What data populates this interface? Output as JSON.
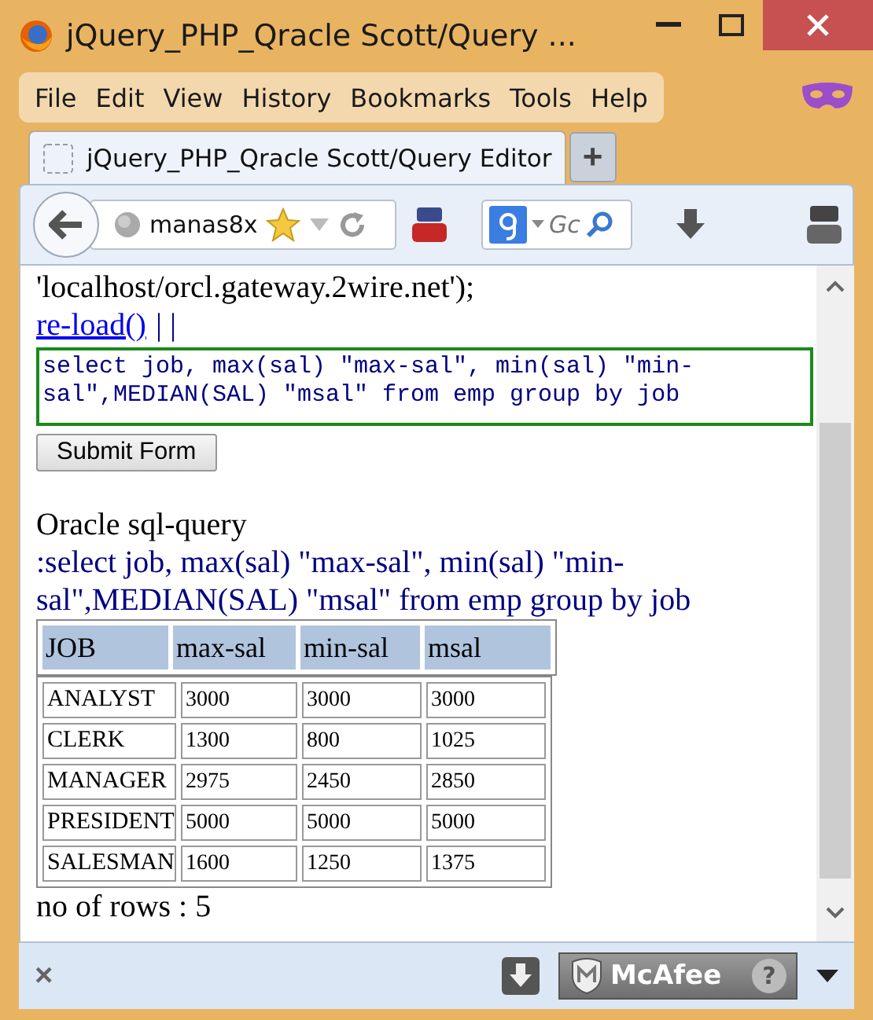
{
  "window": {
    "title": "jQuery_PHP_Qracle Scott/Query ..."
  },
  "menu": [
    {
      "label": "File"
    },
    {
      "label": "Edit"
    },
    {
      "label": "View"
    },
    {
      "label": "History"
    },
    {
      "label": "Bookmarks"
    },
    {
      "label": "Tools"
    },
    {
      "label": "Help"
    }
  ],
  "tabs": [
    {
      "label": "jQuery_PHP_Qracle Scott/Query Editor",
      "selected": true
    }
  ],
  "new_tab": "+",
  "address": {
    "value": "manas8x"
  },
  "search": {
    "placeholder": "Gc"
  },
  "page": {
    "intro": "'localhost/orcl.gateway.2wire.net');",
    "link": "re-load()",
    "separator": "| |",
    "query": "select job, max(sal) \"max-sal\", min(sal) \"min-sal\",MEDIAN(SAL) \"msal\" from emp group by job",
    "submit": "Submit Form",
    "heading": "Oracle sql-query",
    "echo": ":select job, max(sal) \"max-sal\", min(sal) \"min-sal\",MEDIAN(SAL) \"msal\" from emp group by job",
    "table": {
      "columns": [
        "JOB",
        "max-sal",
        "min-sal",
        "msal"
      ],
      "rows": [
        [
          "ANALYST",
          "3000",
          "3000",
          "3000"
        ],
        [
          "CLERK",
          "1300",
          "800",
          "1025"
        ],
        [
          "MANAGER",
          "2975",
          "2450",
          "2850"
        ],
        [
          "PRESIDENT",
          "5000",
          "5000",
          "5000"
        ],
        [
          "SALESMAN",
          "1600",
          "1250",
          "1375"
        ]
      ]
    },
    "row_count": "no of rows : 5"
  },
  "addon_bar": {
    "close": "×",
    "mcafee": "McAfee",
    "help": "?"
  }
}
